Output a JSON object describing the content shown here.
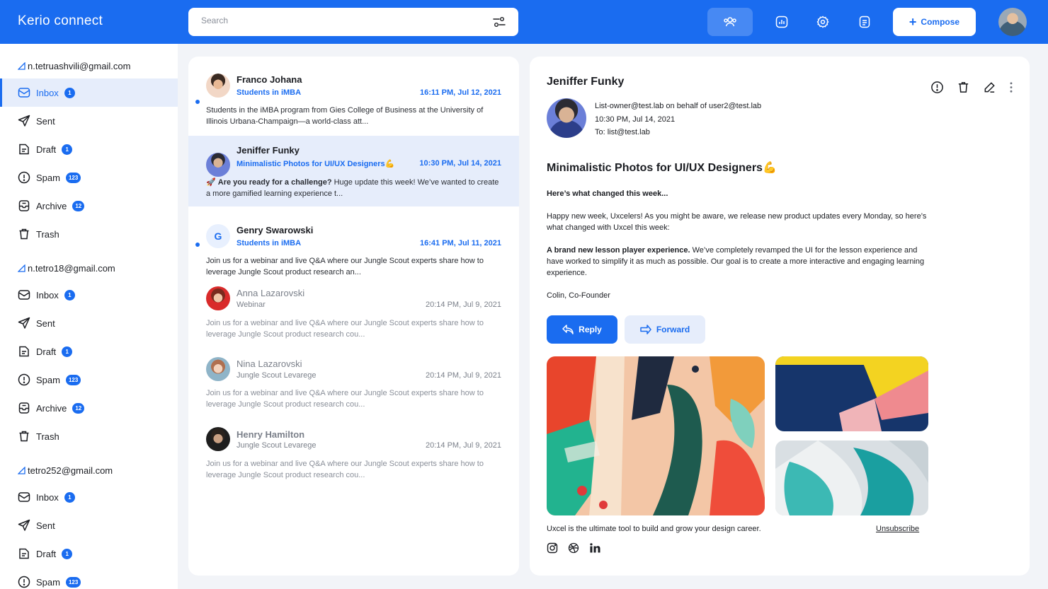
{
  "header": {
    "logo": "Kerio connect",
    "search_placeholder": "Search",
    "compose_label": "Compose",
    "icons": [
      "contacts-icon",
      "stats-icon",
      "settings-icon",
      "notes-icon"
    ]
  },
  "accounts": [
    {
      "email": "n.tetruashvili@gmail.com",
      "folders": [
        {
          "label": "Inbox",
          "badge": "1"
        },
        {
          "label": "Sent",
          "badge": ""
        },
        {
          "label": "Draft",
          "badge": "1"
        },
        {
          "label": "Spam",
          "badge": "123"
        },
        {
          "label": "Archive",
          "badge": "12"
        },
        {
          "label": "Trash",
          "badge": ""
        }
      ]
    },
    {
      "email": "n.tetro18@gmail.com",
      "folders": [
        {
          "label": "Inbox",
          "badge": "1"
        },
        {
          "label": "Sent",
          "badge": ""
        },
        {
          "label": "Draft",
          "badge": "1"
        },
        {
          "label": "Spam",
          "badge": "123"
        },
        {
          "label": "Archive",
          "badge": "12"
        },
        {
          "label": "Trash",
          "badge": ""
        }
      ]
    },
    {
      "email": "tetro252@gmail.com",
      "folders": [
        {
          "label": "Inbox",
          "badge": "1"
        },
        {
          "label": "Sent",
          "badge": ""
        },
        {
          "label": "Draft",
          "badge": "1"
        },
        {
          "label": "Spam",
          "badge": "123"
        }
      ]
    }
  ],
  "emails": [
    {
      "name": "Franco Johana",
      "subject": "Students in iMBA",
      "time": "16:11 PM, Jul 12, 2021",
      "preview": "Students in the iMBA program from Gies College of Business at the University of Illinois Urbana-Champaign—a world-class att..."
    },
    {
      "name": "Jeniffer Funky",
      "subject": "Minimalistic Photos for UI/UX Designers💪",
      "time": "10:30 PM, Jul 14, 2021",
      "preview_bold": "Are you ready for a challenge?",
      "preview": " Huge update this week! We’ve wanted to create a more gamified learning experience t..."
    },
    {
      "name": "Genry Swarowski",
      "subject": "Students in iMBA",
      "time": "16:41 PM, Jul 11, 2021",
      "preview": "Join us for a webinar and live Q&A where our Jungle Scout experts share how to leverage Jungle Scout product research an..."
    },
    {
      "name": "Anna Lazarovski",
      "subject": "Webinar",
      "time": "20:14 PM, Jul 9, 2021",
      "preview": "Join us for a webinar and live Q&A where our Jungle Scout experts share how to leverage Jungle Scout product research cou..."
    },
    {
      "name": "Nina Lazarovski",
      "subject": "Jungle Scout Levarege",
      "time": "20:14 PM, Jul 9, 2021",
      "preview": "Join us for a webinar and live Q&A where our Jungle Scout experts share how to leverage Jungle Scout product research cou..."
    },
    {
      "name": "Henry Hamilton",
      "subject": "Jungle Scout Levarege",
      "time": "20:14 PM, Jul 9, 2021",
      "preview": "Join us for a webinar and live Q&A where our Jungle Scout experts share how to leverage Jungle Scout product research cou..."
    }
  ],
  "reader": {
    "sender": "Jeniffer Funky",
    "from_line": "List-owner@test.lab on behalf of user2@test.lab",
    "date_line": "10:30 PM, Jul 14, 2021",
    "to_line": "To: list@test.lab",
    "subject": "Minimalistic Photos for UI/UX Designers💪",
    "intro": "Here’s what changed this week...",
    "para1": "Happy new week, Uxcelers! As you might be aware, we release new product updates every Monday, so here’s what changed with Uxcel this week:",
    "para2_bold": "A brand new lesson player experience.",
    "para2": " We’ve completely revamped the UI for the lesson experience and have worked to simplify it as much as possible. Our goal is to create a more interactive and engaging learning experience.",
    "signature": "Colin, Co-Founder",
    "reply_label": "Reply",
    "forward_label": "Forward",
    "footer": "Uxcel is the ultimate tool to build and grow your design career.",
    "unsubscribe": "Unsubscribe"
  },
  "colors": {
    "accent": "#1a6cf0",
    "selected_bg": "#e6edfb"
  }
}
